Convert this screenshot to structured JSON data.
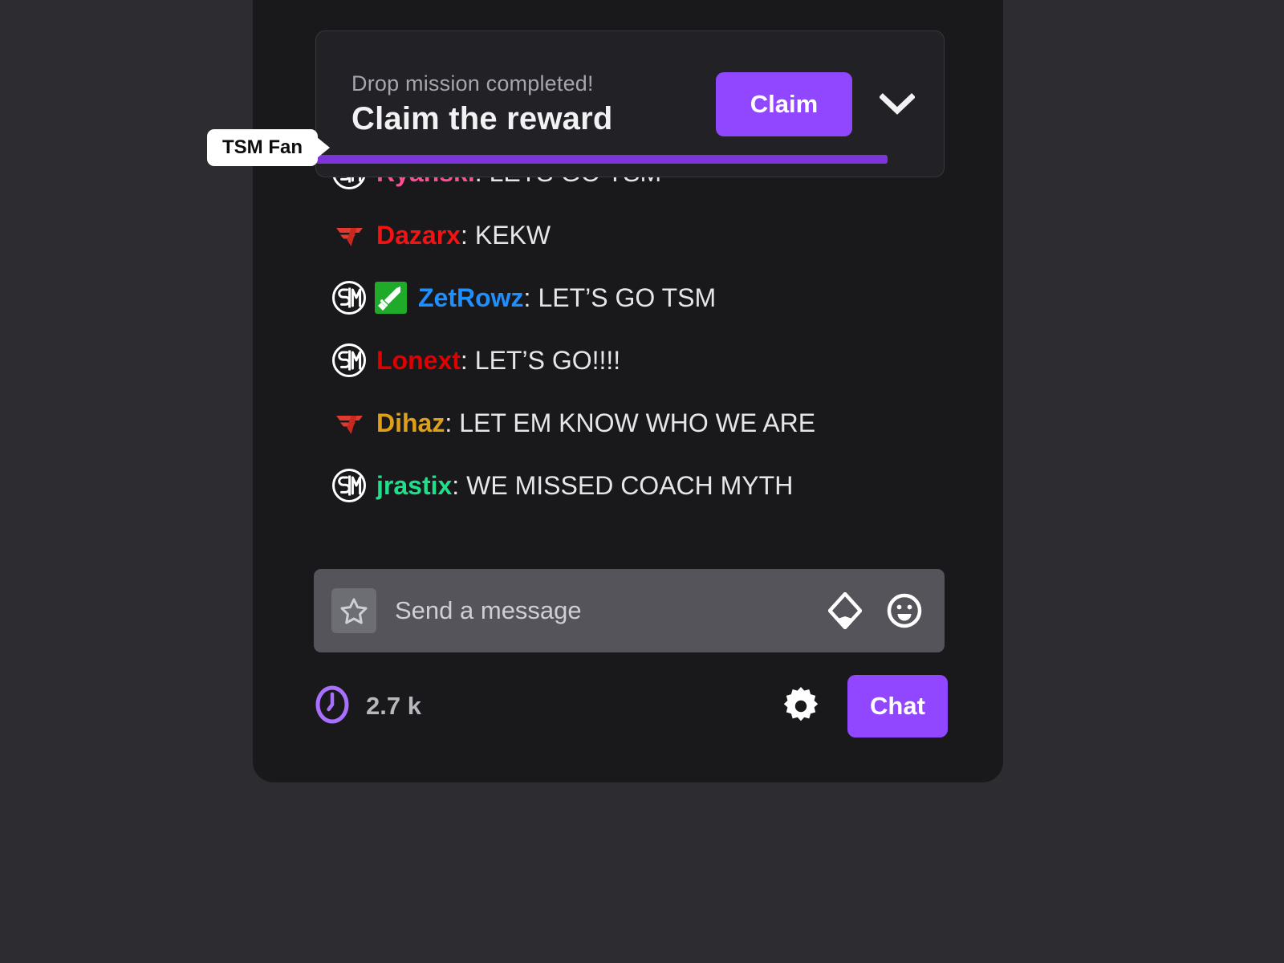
{
  "panel": {
    "background_color": "#19191c",
    "page_background_color": "#2c2c31"
  },
  "drop_mission": {
    "subtitle": "Drop mission completed!",
    "title": "Claim the reward",
    "claim_label": "Claim",
    "collapse_icon": "chevron-down-icon",
    "progress_percent": 91,
    "progress_color": "#7b35d8",
    "accent_color": "#9147ff"
  },
  "tooltip": {
    "label": "TSM Fan",
    "background_color": "#ffffff",
    "text_color": "#0d0d0f"
  },
  "chat": {
    "messages": [
      {
        "badges": [
          "tsm-badge"
        ],
        "user": "Ryanski",
        "color": "#ff4d94",
        "text": "LETS GO TSM"
      },
      {
        "badges": [
          "faze-badge"
        ],
        "user": "Dazarx",
        "color": "#f41212",
        "text": "KEKW"
      },
      {
        "badges": [
          "tsm-badge",
          "sword-badge"
        ],
        "user": "ZetRowz",
        "color": "#1f8fff",
        "text": "LET’S GO TSM"
      },
      {
        "badges": [
          "tsm-badge"
        ],
        "user": "Lonext",
        "color": "#e00000",
        "text": "LET’S GO!!!!"
      },
      {
        "badges": [
          "faze-badge"
        ],
        "user": "Dihaz",
        "color": "#dfa019",
        "text": "LET EM KNOW WHO WE ARE"
      },
      {
        "badges": [
          "tsm-badge"
        ],
        "user": "jrastix",
        "color": "#1ee08a",
        "text": "WE MISSED COACH MYTH"
      }
    ]
  },
  "message_input": {
    "placeholder": "Send a message",
    "star_icon": "star-icon",
    "bits_icon": "bits-gem-icon",
    "emote_icon": "emote-smiley-icon",
    "background_color": "#54545a"
  },
  "bottom_bar": {
    "viewer_icon": "viewer-count-icon",
    "viewer_count": "2.7 k",
    "settings_icon": "gear-icon",
    "chat_label": "Chat"
  }
}
